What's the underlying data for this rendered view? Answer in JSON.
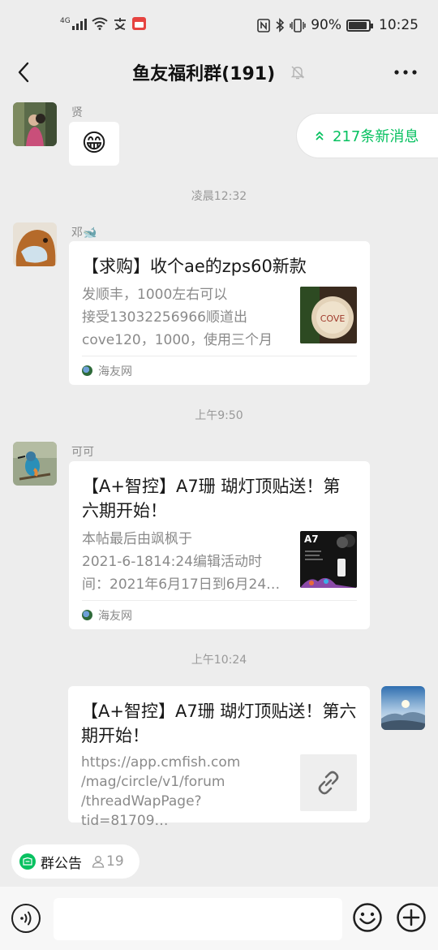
{
  "status_bar": {
    "network": "4G",
    "battery": "90%",
    "battery_level": 0.9,
    "time": "10:25"
  },
  "header": {
    "title": "鱼友福利群(191)",
    "back_icon": "chevron-left-icon",
    "mute_icon": "bell-off-icon",
    "more_icon": "more-dots-icon"
  },
  "new_messages": {
    "text": "217条新消息",
    "icon": "double-chevron-up-icon",
    "color": "#07c160"
  },
  "messages": [
    {
      "type": "emoji",
      "sender": "贤",
      "emoji": "😁"
    },
    {
      "type": "time",
      "text": "凌晨12:32"
    },
    {
      "type": "link_card",
      "sender": "邓🐋",
      "title": "【求购】收个ae的zps60新款",
      "desc": "发顺丰，1000左右可以\n接受13032256966顺道出\ncove120，1000，使用三个月",
      "thumb_text": "COVE",
      "source": "海友网"
    },
    {
      "type": "time",
      "text": "上午9:50"
    },
    {
      "type": "link_card",
      "sender": "可可",
      "title": "【A+智控】A7珊 瑚灯顶贴送！第六期开始！",
      "desc": "本帖最后由飒枫于\n2021-6-1814:24编辑活动时\n间：2021年6月17日到6月24…",
      "thumb_text": "A7",
      "source": "海友网"
    },
    {
      "type": "time",
      "text": "上午10:24"
    },
    {
      "type": "link_card_self",
      "title": "【A+智控】A7珊 瑚灯顶贴送！第六期开始！",
      "desc": "https://app.cmfish.com\n/mag/circle/v1/forum\n/threadWapPage?tid=81709…",
      "thumb_icon": "link-icon"
    }
  ],
  "notice": {
    "label": "群公告",
    "count": "19"
  },
  "input": {
    "placeholder": "",
    "voice_icon": "voice-icon",
    "emoji_icon": "emoji-icon",
    "plus_icon": "plus-icon"
  }
}
